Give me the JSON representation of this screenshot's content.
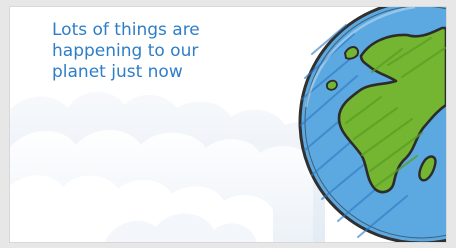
{
  "slide": {
    "title": "Lots of things are\nhappening to our\nplanet just now"
  },
  "colors": {
    "title_text": "#2e7ec7",
    "ocean": "#5aa7df",
    "land": "#72b531",
    "outline": "#2f2f2f",
    "clouds": "#e7edf5"
  },
  "icons": {
    "earth": "earth-globe-illustration",
    "clouds": "clouds-background"
  }
}
